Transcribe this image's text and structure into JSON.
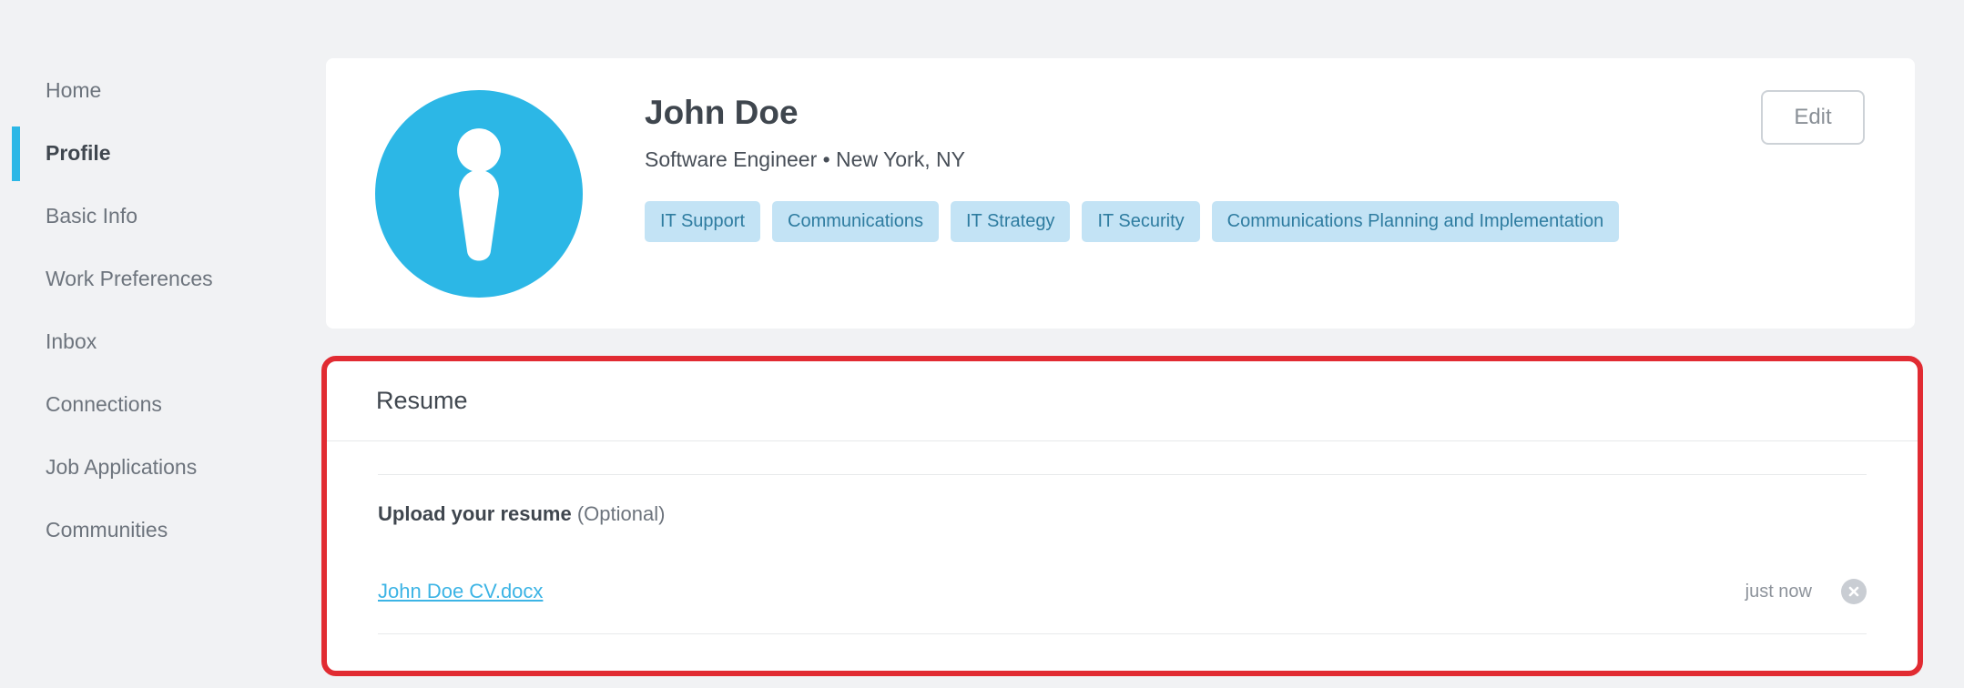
{
  "sidebar": {
    "items": [
      {
        "label": "Home",
        "active": false
      },
      {
        "label": "Profile",
        "active": true
      },
      {
        "label": "Basic Info",
        "active": false
      },
      {
        "label": "Work Preferences",
        "active": false
      },
      {
        "label": "Inbox",
        "active": false
      },
      {
        "label": "Connections",
        "active": false
      },
      {
        "label": "Job Applications",
        "active": false
      },
      {
        "label": "Communities",
        "active": false
      }
    ]
  },
  "profile_card": {
    "name": "John Doe",
    "headline": "Software Engineer • New York, NY",
    "tags": [
      "IT Support",
      "Communications",
      "IT Strategy",
      "IT Security",
      "Communications Planning and Implementation"
    ],
    "edit_button": "Edit",
    "avatar_icon": "person-icon"
  },
  "resume_section": {
    "title": "Resume",
    "upload_label": "Upload your resume",
    "upload_hint": "(Optional)",
    "file": {
      "name": "John Doe CV.docx",
      "uploaded_time": "just now",
      "remove_icon": "close-icon"
    }
  },
  "colors": {
    "page_background": "#f1f2f4",
    "accent_cyan": "#2cb7e6",
    "tag_background": "#c3e3f5",
    "tag_text": "#2e7ca0",
    "link": "#3cb4e5",
    "annotation_red": "#e12b32"
  }
}
